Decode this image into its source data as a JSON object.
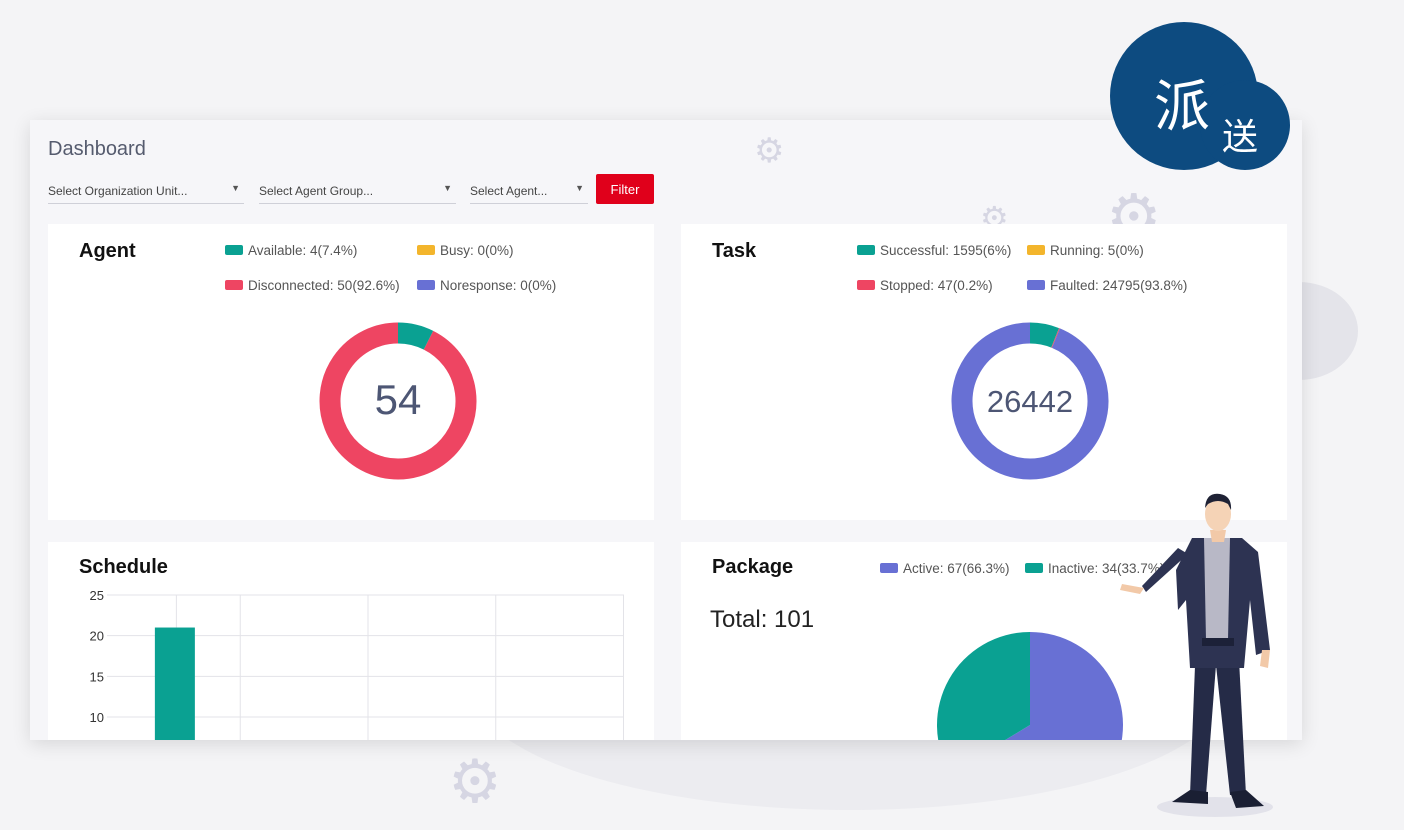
{
  "app": {
    "title": "Dashboard",
    "badge_char_1": "派",
    "badge_char_2": "送"
  },
  "filters": {
    "org_unit": "Select Organization Unit...",
    "agent_group": "Select Agent Group...",
    "agent": "Select Agent...",
    "filter_label": "Filter"
  },
  "colors": {
    "teal": "#0aa192",
    "red": "#ee4562",
    "amber": "#f3b52c",
    "purple": "#6870d4",
    "brand_red": "#e0001b",
    "brand_blue": "#0d4b80"
  },
  "agent": {
    "title": "Agent",
    "legend": {
      "available": "Available: 4(7.4%)",
      "busy": "Busy: 0(0%)",
      "disconnected": "Disconnected: 50(92.6%)",
      "noresponse": "Noresponse: 0(0%)"
    },
    "total": "54"
  },
  "task": {
    "title": "Task",
    "legend": {
      "successful": "Successful: 1595(6%)",
      "running": "Running: 5(0%)",
      "stopped": "Stopped: 47(0.2%)",
      "faulted": "Faulted: 24795(93.8%)"
    },
    "total": "26442"
  },
  "schedule": {
    "title": "Schedule"
  },
  "package": {
    "title": "Package",
    "legend": {
      "active": "Active: 67(66.3%)",
      "inactive": "Inactive: 34(33.7%)"
    },
    "total": "Total: 101"
  },
  "chart_data": [
    {
      "type": "pie",
      "variant": "donut",
      "categories": [
        "Available",
        "Busy",
        "Disconnected",
        "Noresponse"
      ],
      "values": [
        4,
        0,
        50,
        0
      ],
      "title": "Agent"
    },
    {
      "type": "pie",
      "variant": "donut",
      "categories": [
        "Successful",
        "Running",
        "Stopped",
        "Faulted"
      ],
      "values": [
        1595,
        5,
        47,
        24795
      ],
      "title": "Task"
    },
    {
      "type": "bar",
      "title": "Schedule",
      "y_ticks": [
        10,
        15,
        20,
        25
      ],
      "visible_ylim": [
        10,
        25
      ],
      "values": [
        21
      ],
      "grid": true
    },
    {
      "type": "pie",
      "categories": [
        "Active",
        "Inactive"
      ],
      "values": [
        67,
        34
      ],
      "title": "Package"
    }
  ]
}
